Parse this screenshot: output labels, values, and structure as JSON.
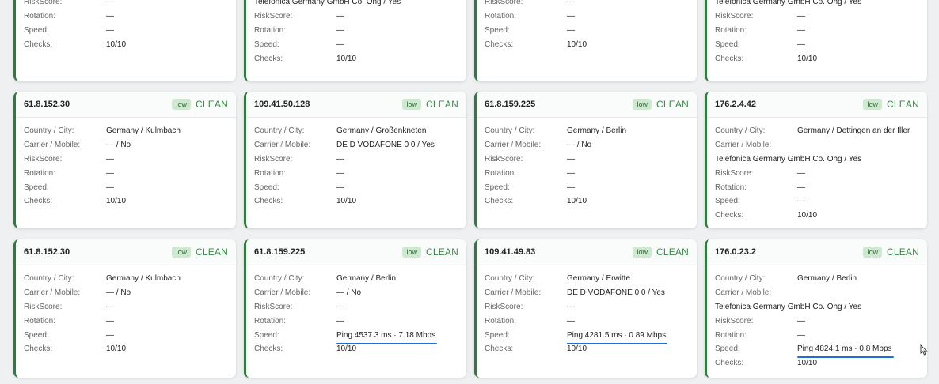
{
  "cards": [
    {
      "ip": "",
      "badge": "",
      "status": "",
      "rows": [
        {
          "label": "RiskScore:",
          "value": "—"
        },
        {
          "label": "Rotation:",
          "value": "—"
        },
        {
          "label": "Speed:",
          "value": "—"
        },
        {
          "label": "Checks:",
          "value": "10/10"
        }
      ]
    },
    {
      "ip": "",
      "badge": "",
      "status": "",
      "rows": [
        {
          "label": "",
          "value": "Telefonica Germany GmbH Co. Ohg / Yes",
          "full": true
        },
        {
          "label": "RiskScore:",
          "value": "—"
        },
        {
          "label": "Rotation:",
          "value": "—"
        },
        {
          "label": "Speed:",
          "value": "—"
        },
        {
          "label": "Checks:",
          "value": "10/10"
        }
      ]
    },
    {
      "ip": "",
      "badge": "",
      "status": "",
      "rows": [
        {
          "label": "RiskScore:",
          "value": "—"
        },
        {
          "label": "Rotation:",
          "value": "—"
        },
        {
          "label": "Speed:",
          "value": "—"
        },
        {
          "label": "Checks:",
          "value": "10/10"
        }
      ]
    },
    {
      "ip": "",
      "badge": "",
      "status": "",
      "rows": [
        {
          "label": "",
          "value": "Telefonica Germany GmbH Co. Ohg / Yes",
          "full": true
        },
        {
          "label": "RiskScore:",
          "value": "—"
        },
        {
          "label": "Rotation:",
          "value": "—"
        },
        {
          "label": "Speed:",
          "value": "—"
        },
        {
          "label": "Checks:",
          "value": "10/10"
        }
      ]
    },
    {
      "ip": "61.8.152.30",
      "badge": "low",
      "status": "CLEAN",
      "rows": [
        {
          "label": "Country / City:",
          "value": "Germany / Kulmbach"
        },
        {
          "label": "Carrier / Mobile:",
          "value": "— / No"
        },
        {
          "label": "RiskScore:",
          "value": "—"
        },
        {
          "label": "Rotation:",
          "value": "—"
        },
        {
          "label": "Speed:",
          "value": "—"
        },
        {
          "label": "Checks:",
          "value": "10/10"
        }
      ]
    },
    {
      "ip": "109.41.50.128",
      "badge": "low",
      "status": "CLEAN",
      "rows": [
        {
          "label": "Country / City:",
          "value": "Germany / Großenkneten"
        },
        {
          "label": "Carrier / Mobile:",
          "value": "DE D VODAFONE 0 0 / Yes"
        },
        {
          "label": "RiskScore:",
          "value": "—"
        },
        {
          "label": "Rotation:",
          "value": "—"
        },
        {
          "label": "Speed:",
          "value": "—"
        },
        {
          "label": "Checks:",
          "value": "10/10"
        }
      ]
    },
    {
      "ip": "61.8.159.225",
      "badge": "low",
      "status": "CLEAN",
      "rows": [
        {
          "label": "Country / City:",
          "value": "Germany / Berlin"
        },
        {
          "label": "Carrier / Mobile:",
          "value": "— / No"
        },
        {
          "label": "RiskScore:",
          "value": "—"
        },
        {
          "label": "Rotation:",
          "value": "—"
        },
        {
          "label": "Speed:",
          "value": "—"
        },
        {
          "label": "Checks:",
          "value": "10/10"
        }
      ]
    },
    {
      "ip": "176.2.4.42",
      "badge": "low",
      "status": "CLEAN",
      "rows": [
        {
          "label": "Country / City:",
          "value": "Germany / Dettingen an der Iller"
        },
        {
          "label": "Carrier / Mobile:",
          "value": ""
        },
        {
          "label": "",
          "value": "Telefonica Germany GmbH Co. Ohg / Yes",
          "full": true
        },
        {
          "label": "RiskScore:",
          "value": "—"
        },
        {
          "label": "Rotation:",
          "value": "—"
        },
        {
          "label": "Speed:",
          "value": "—"
        },
        {
          "label": "Checks:",
          "value": "10/10"
        }
      ]
    },
    {
      "ip": "61.8.152.30",
      "badge": "low",
      "status": "CLEAN",
      "rows": [
        {
          "label": "Country / City:",
          "value": "Germany / Kulmbach"
        },
        {
          "label": "Carrier / Mobile:",
          "value": "— / No"
        },
        {
          "label": "RiskScore:",
          "value": "—"
        },
        {
          "label": "Rotation:",
          "value": "—"
        },
        {
          "label": "Speed:",
          "value": "—"
        },
        {
          "label": "Checks:",
          "value": "10/10"
        }
      ]
    },
    {
      "ip": "61.8.159.225",
      "badge": "low",
      "status": "CLEAN",
      "rows": [
        {
          "label": "Country / City:",
          "value": "Germany / Berlin"
        },
        {
          "label": "Carrier / Mobile:",
          "value": "— / No"
        },
        {
          "label": "RiskScore:",
          "value": "—"
        },
        {
          "label": "Rotation:",
          "value": "—"
        },
        {
          "label": "Speed:",
          "value": "Ping 4537.3 ms · 7.18 Mbps",
          "underline": true
        },
        {
          "label": "Checks:",
          "value": "10/10"
        }
      ]
    },
    {
      "ip": "109.41.49.83",
      "badge": "low",
      "status": "CLEAN",
      "rows": [
        {
          "label": "Country / City:",
          "value": "Germany / Erwitte"
        },
        {
          "label": "Carrier / Mobile:",
          "value": "DE D VODAFONE 0 0 / Yes"
        },
        {
          "label": "RiskScore:",
          "value": "—"
        },
        {
          "label": "Rotation:",
          "value": "—"
        },
        {
          "label": "Speed:",
          "value": "Ping 4281.5 ms · 0.89 Mbps",
          "underline": true
        },
        {
          "label": "Checks:",
          "value": "10/10"
        }
      ]
    },
    {
      "ip": "176.0.23.2",
      "badge": "low",
      "status": "CLEAN",
      "rows": [
        {
          "label": "Country / City:",
          "value": "Germany / Berlin"
        },
        {
          "label": "Carrier / Mobile:",
          "value": ""
        },
        {
          "label": "",
          "value": "Telefonica Germany GmbH Co. Ohg / Yes",
          "full": true
        },
        {
          "label": "RiskScore:",
          "value": "—"
        },
        {
          "label": "Rotation:",
          "value": "—"
        },
        {
          "label": "Speed:",
          "value": "Ping 4824.1 ms · 0.8 Mbps",
          "underline": true
        },
        {
          "label": "Checks:",
          "value": "10/10"
        }
      ]
    }
  ],
  "colors": {
    "accent": "#2f7d3d",
    "clean": "#3a8a48",
    "badge_bg": "#cfe8d0",
    "underline": "#1f6fd8"
  }
}
